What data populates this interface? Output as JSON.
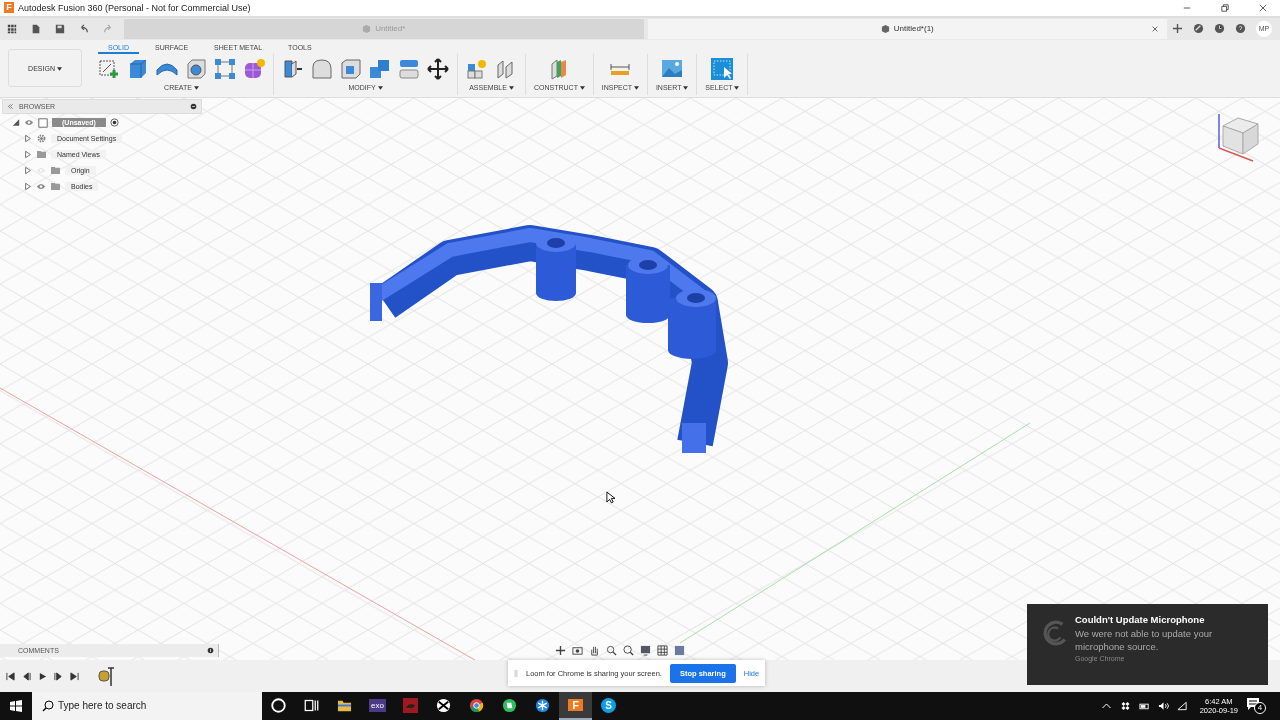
{
  "title_bar": {
    "logo": "F",
    "title": "Autodesk Fusion 360 (Personal - Not for Commercial Use)"
  },
  "document_tabs": [
    {
      "label": "Untitled*",
      "selected": false
    },
    {
      "label": "Untitled*(1)",
      "selected": true
    }
  ],
  "user_initials": "MP",
  "toolbar": {
    "workspace": "DESIGN",
    "tabs": [
      {
        "label": "SOLID",
        "selected": true
      },
      {
        "label": "SURFACE",
        "selected": false
      },
      {
        "label": "SHEET METAL",
        "selected": false
      },
      {
        "label": "TOOLS",
        "selected": false
      }
    ],
    "groups": [
      {
        "label": "CREATE"
      },
      {
        "label": "MODIFY"
      },
      {
        "label": "ASSEMBLE"
      },
      {
        "label": "CONSTRUCT"
      },
      {
        "label": "INSPECT"
      },
      {
        "label": "INSERT"
      },
      {
        "label": "SELECT"
      }
    ]
  },
  "browser": {
    "title": "BROWSER",
    "items": [
      {
        "label": "(Unsaved)",
        "selected": true,
        "expanded": true,
        "visible": true,
        "children": [
          {
            "label": "Document Settings",
            "selected": false,
            "kind": "settings",
            "expanded": false
          },
          {
            "label": "Named Views",
            "selected": false,
            "kind": "folder",
            "expanded": false
          },
          {
            "label": "Origin",
            "selected": false,
            "kind": "folder",
            "expanded": false,
            "visible": false
          },
          {
            "label": "Bodies",
            "selected": false,
            "kind": "folder",
            "expanded": false,
            "visible": true
          }
        ]
      }
    ]
  },
  "comments": {
    "title": "COMMENTS"
  },
  "screen_share_banner": {
    "message": "Loom for Chrome is sharing your screen.",
    "stop_button": "Stop sharing",
    "hide_link": "Hide"
  },
  "notification": {
    "title": "Couldn't Update Microphone",
    "body": "We were not able to update your microphone source.",
    "source": "Google Chrome"
  },
  "taskbar": {
    "search_placeholder": "Type here to search",
    "apps": [
      {
        "kind": "cortana",
        "selected": false
      },
      {
        "kind": "taskview",
        "selected": false
      },
      {
        "kind": "explorer",
        "selected": false
      },
      {
        "kind": "exo",
        "label": "exo",
        "selected": false
      },
      {
        "kind": "red",
        "selected": false
      },
      {
        "kind": "xbox",
        "selected": false
      },
      {
        "kind": "chrome",
        "selected": false
      },
      {
        "kind": "evernote",
        "selected": false
      },
      {
        "kind": "snow",
        "selected": false
      },
      {
        "kind": "fusion",
        "label": "F",
        "selected": true
      },
      {
        "kind": "skype",
        "label": "S",
        "selected": false
      }
    ],
    "time": "6:42 AM",
    "date": "2020-09-19",
    "notification_count": "4"
  }
}
